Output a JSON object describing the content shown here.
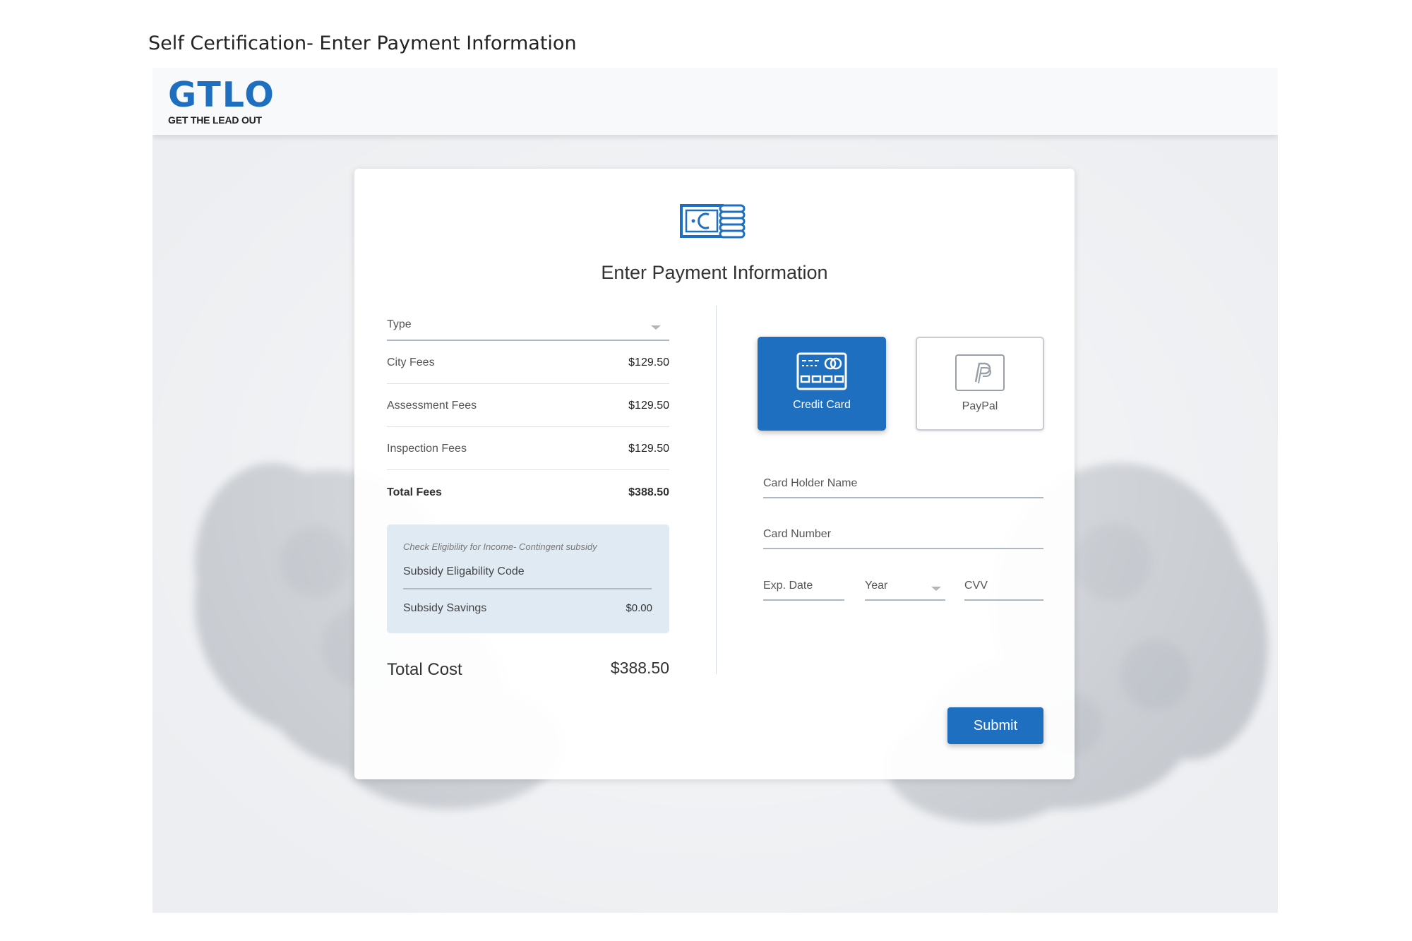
{
  "document": {
    "title": "Self Certification- Enter Payment Information"
  },
  "header": {
    "logo_main": "GTLO",
    "logo_sub": "GET THE LEAD OUT"
  },
  "card": {
    "title": "Enter Payment Information"
  },
  "fees": {
    "type_label": "Type",
    "rows": [
      {
        "name": "City Fees",
        "amount": "$129.50"
      },
      {
        "name": "Assessment Fees",
        "amount": "$129.50"
      },
      {
        "name": "Inspection Fees",
        "amount": "$129.50"
      }
    ],
    "total": {
      "name": "Total Fees",
      "amount": "$388.50"
    }
  },
  "subsidy": {
    "hint": "Check Eligibility for Income- Contingent subsidy",
    "code_label": "Subsidy Eligability Code",
    "savings_label": "Subsidy Savings",
    "savings_amount": "$0.00"
  },
  "total_cost": {
    "label": "Total Cost",
    "amount": "$388.50"
  },
  "payment": {
    "methods": [
      {
        "label": "Credit Card",
        "selected": true,
        "icon": "credit-card-icon"
      },
      {
        "label": "PayPal",
        "selected": false,
        "icon": "paypal-icon"
      }
    ],
    "card_holder_label": "Card Holder Name",
    "card_number_label": "Card Number",
    "exp_date_label": "Exp. Date",
    "year_label": "Year",
    "cvv_label": "CVV"
  },
  "submit_label": "Submit",
  "colors": {
    "accent": "#1e6fbf",
    "background": "#eceef1",
    "subsidy_panel": "#dfeaf3"
  }
}
